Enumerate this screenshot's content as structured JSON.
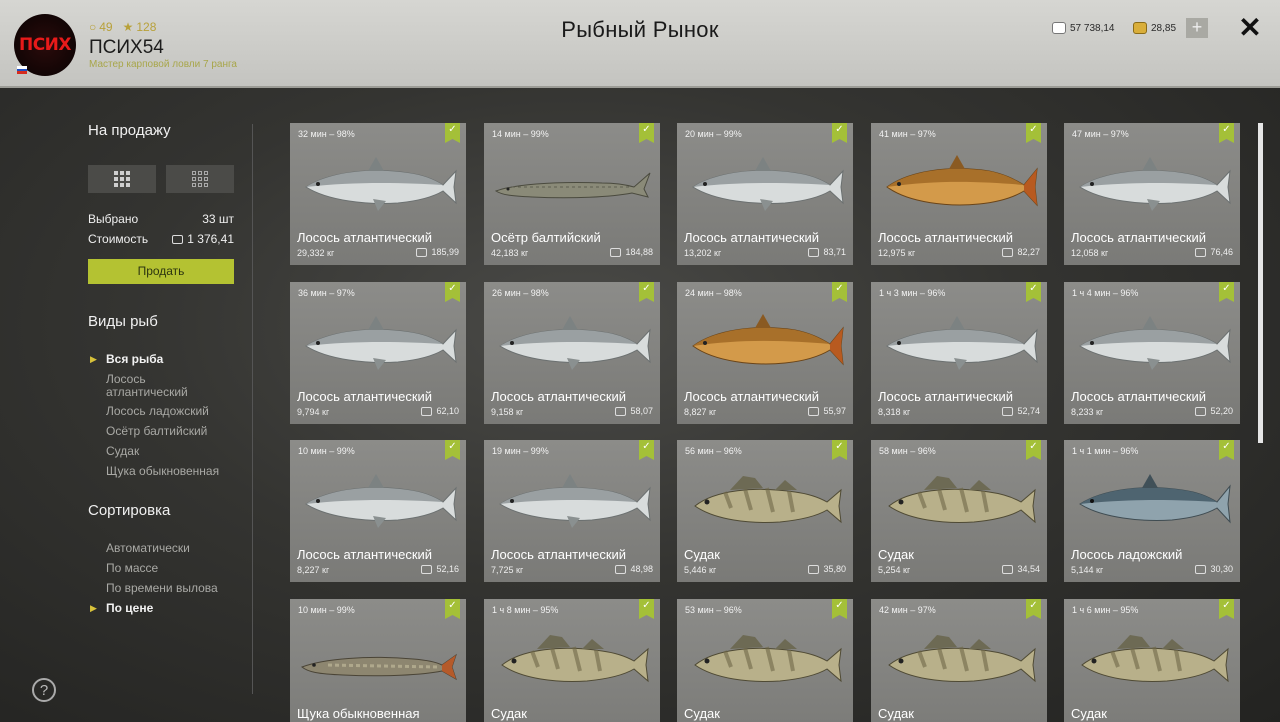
{
  "header": {
    "title": "Рыбный Рынок",
    "avatar_text": "ПСИХ",
    "username": "ПСИХ54",
    "rank": "Мастер карповой ловли 7 ранга",
    "stat1": "49",
    "stat2": "128",
    "currency_silver": "57 738,14",
    "currency_gold": "28,85",
    "plus": "+",
    "close": "✕"
  },
  "sidebar": {
    "for_sale": "На продажу",
    "selected_label": "Выбрано",
    "selected_value": "33 шт",
    "cost_label": "Стоимость",
    "cost_value": "1 376,41",
    "sell_button": "Продать",
    "fish_types_title": "Виды рыб",
    "fish_types": [
      "Вся рыба",
      "Лосось\nатлантический",
      "Лосось ладожский",
      "Осётр балтийский",
      "Судак",
      "Щука обыкновенная"
    ],
    "sort_title": "Сортировка",
    "sort_options": [
      "Автоматически",
      "По массе",
      "По времени вылова",
      "По цене"
    ],
    "help": "?"
  },
  "fish": [
    {
      "time": "32 мин – 98%",
      "name": "Лосось атлантический",
      "weight": "29,332 кг",
      "price": "185,99",
      "kind": "salmon"
    },
    {
      "time": "14 мин – 99%",
      "name": "Осётр балтийский",
      "weight": "42,183 кг",
      "price": "184,88",
      "kind": "sturgeon"
    },
    {
      "time": "20 мин – 99%",
      "name": "Лосось атлантический",
      "weight": "13,202 кг",
      "price": "83,71",
      "kind": "salmon"
    },
    {
      "time": "41 мин – 97%",
      "name": "Лосось атлантический",
      "weight": "12,975 кг",
      "price": "82,27",
      "kind": "brown"
    },
    {
      "time": "47 мин – 97%",
      "name": "Лосось атлантический",
      "weight": "12,058 кг",
      "price": "76,46",
      "kind": "salmon"
    },
    {
      "time": "36 мин – 97%",
      "name": "Лосось атлантический",
      "weight": "9,794 кг",
      "price": "62,10",
      "kind": "salmon"
    },
    {
      "time": "26 мин – 98%",
      "name": "Лосось атлантический",
      "weight": "9,158 кг",
      "price": "58,07",
      "kind": "salmon"
    },
    {
      "time": "24 мин – 98%",
      "name": "Лосось атлантический",
      "weight": "8,827 кг",
      "price": "55,97",
      "kind": "brown"
    },
    {
      "time": "1 ч 3 мин – 96%",
      "name": "Лосось атлантический",
      "weight": "8,318 кг",
      "price": "52,74",
      "kind": "salmon"
    },
    {
      "time": "1 ч 4 мин – 96%",
      "name": "Лосось атлантический",
      "weight": "8,233 кг",
      "price": "52,20",
      "kind": "salmon"
    },
    {
      "time": "10 мин – 99%",
      "name": "Лосось атлантический",
      "weight": "8,227 кг",
      "price": "52,16",
      "kind": "salmon"
    },
    {
      "time": "19 мин – 99%",
      "name": "Лосось атлантический",
      "weight": "7,725 кг",
      "price": "48,98",
      "kind": "salmon"
    },
    {
      "time": "56 мин – 96%",
      "name": "Судак",
      "weight": "5,446 кг",
      "price": "35,80",
      "kind": "zander"
    },
    {
      "time": "58 мин – 96%",
      "name": "Судак",
      "weight": "5,254 кг",
      "price": "34,54",
      "kind": "zander"
    },
    {
      "time": "1 ч 1 мин – 96%",
      "name": "Лосось ладожский",
      "weight": "5,144 кг",
      "price": "30,30",
      "kind": "ladoga"
    },
    {
      "time": "10 мин – 99%",
      "name": "Щука обыкновенная",
      "weight": "",
      "price": "",
      "kind": "pike"
    },
    {
      "time": "1 ч 8 мин – 95%",
      "name": "Судак",
      "weight": "",
      "price": "",
      "kind": "zander"
    },
    {
      "time": "53 мин – 96%",
      "name": "Судак",
      "weight": "",
      "price": "",
      "kind": "zander"
    },
    {
      "time": "42 мин – 97%",
      "name": "Судак",
      "weight": "",
      "price": "",
      "kind": "zander"
    },
    {
      "time": "1 ч 6 мин – 95%",
      "name": "Судак",
      "weight": "",
      "price": "",
      "kind": "zander"
    }
  ],
  "colors": {
    "accent": "#b4c232",
    "check": "#a4c038",
    "bullet": "#d8c23a"
  }
}
